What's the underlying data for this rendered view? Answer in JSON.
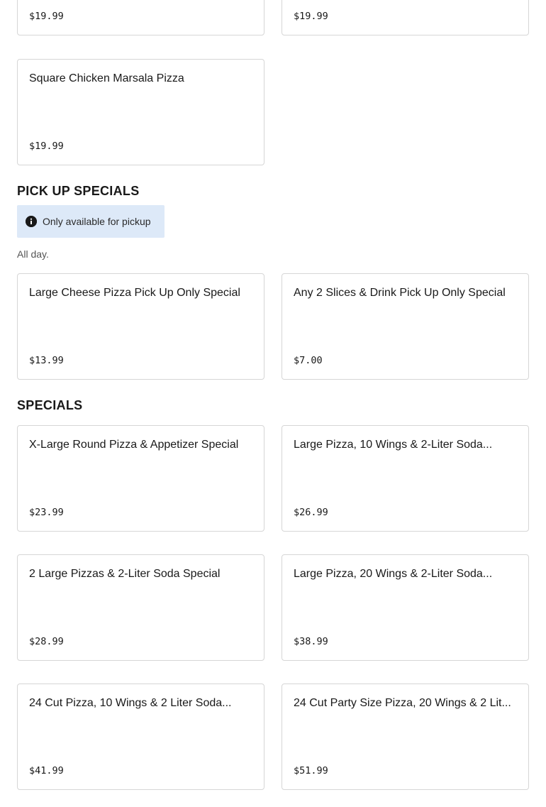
{
  "top_partial_cards": [
    {
      "price": "$19.99"
    },
    {
      "price": "$19.99"
    }
  ],
  "cards_top": [
    {
      "name": "Square Chicken Marsala Pizza",
      "price": "$19.99"
    }
  ],
  "pickup_section": {
    "title": "PICK UP SPECIALS",
    "badge": "Only available for pickup",
    "description": "All day.",
    "items": [
      {
        "name": "Large Cheese Pizza Pick Up Only Special",
        "price": "$13.99"
      },
      {
        "name": "Any 2 Slices & Drink Pick Up Only Special",
        "price": "$7.00"
      }
    ]
  },
  "specials_section": {
    "title": "SPECIALS",
    "items": [
      {
        "name": "X-Large Round Pizza & Appetizer Special",
        "price": "$23.99"
      },
      {
        "name": "Large Pizza, 10 Wings & 2-Liter Soda...",
        "price": "$26.99"
      },
      {
        "name": "2 Large Pizzas & 2-Liter Soda Special",
        "price": "$28.99"
      },
      {
        "name": "Large Pizza, 20 Wings & 2-Liter Soda...",
        "price": "$38.99"
      },
      {
        "name": "24 Cut Pizza, 10 Wings & 2 Liter Soda...",
        "price": "$41.99"
      },
      {
        "name": "24 Cut Party Size Pizza, 20 Wings & 2 Lit...",
        "price": "$51.99"
      }
    ]
  },
  "icons": {
    "info": "info-icon"
  }
}
